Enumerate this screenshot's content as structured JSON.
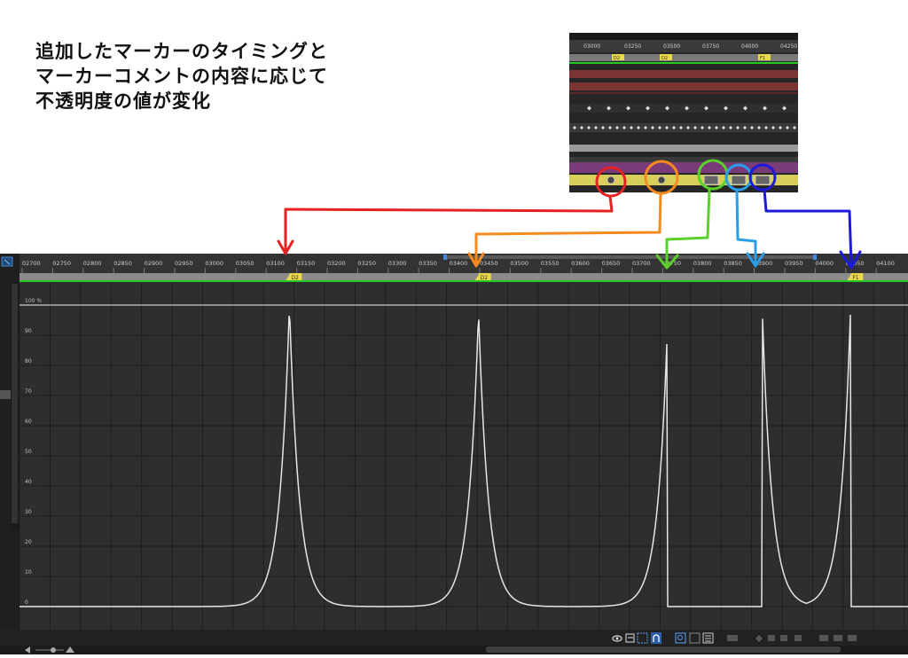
{
  "caption": {
    "line1": "追加したマーカーのタイミングと",
    "line2": "マーカーコメントの内容に応じて",
    "line3": "不透明度の値が変化"
  },
  "inset": {
    "ruler_labels": [
      "03000",
      "03250",
      "03500",
      "03750",
      "04000",
      "04250"
    ],
    "markers": [
      {
        "label": "D2",
        "color": "#e8d84a"
      },
      {
        "label": "D2",
        "color": "#e8d84a"
      },
      {
        "label": "F1",
        "color": "#e8d84a"
      }
    ]
  },
  "editor": {
    "ruler_labels": [
      "02700",
      "02750",
      "02800",
      "02850",
      "02900",
      "02950",
      "03000",
      "03050",
      "03100",
      "03150",
      "03200",
      "03250",
      "03300",
      "03350",
      "03400",
      "03450",
      "03500",
      "03550",
      "03600",
      "03650",
      "03700",
      "03750",
      "03800",
      "03850",
      "03900",
      "03950",
      "04000",
      "04050",
      "04100"
    ],
    "markers": [
      {
        "label": "D2",
        "time": "03125"
      },
      {
        "label": "D2",
        "time": "03435"
      },
      {
        "label": "F1",
        "time": "04045"
      }
    ],
    "y_axis_labels": [
      "100 %",
      "90",
      "80",
      "70",
      "60",
      "50",
      "40",
      "30",
      "20",
      "10",
      "0"
    ],
    "toolbar_icons": [
      "eye-icon",
      "graph-type-icon",
      "transform-box-icon",
      "snap-icon",
      "fit-selection-icon",
      "fit-all-icon",
      "graph-editor-settings-icon"
    ]
  },
  "chart_data": {
    "type": "line",
    "x_unit": "frames",
    "ylim": [
      0,
      100
    ],
    "peaks": [
      {
        "time": 3125,
        "value": 100,
        "shape": "symmetric"
      },
      {
        "time": 3435,
        "value": 98,
        "shape": "symmetric"
      },
      {
        "time": 3745,
        "value": 95,
        "shape": "rise-then-drop"
      },
      {
        "time": 3900,
        "value": 99,
        "shape": "drop-then-decay"
      },
      {
        "time": 4045,
        "value": 100,
        "shape": "rise-then-drop"
      }
    ]
  },
  "annotations": {
    "colors": [
      "#e62222",
      "#f58a1f",
      "#5ad12a",
      "#2a9de8",
      "#1a1ad8"
    ]
  }
}
